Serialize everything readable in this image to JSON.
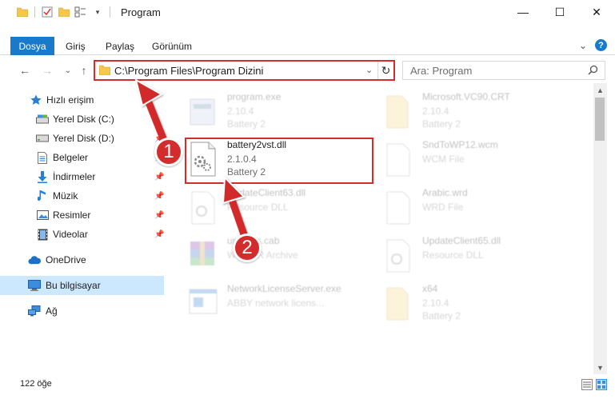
{
  "window": {
    "title": "Program",
    "minimize_glyph": "—",
    "maximize_glyph": "☐",
    "close_glyph": "✕"
  },
  "ribbon": {
    "tabs": [
      "Dosya",
      "Giriş",
      "Paylaş",
      "Görünüm"
    ],
    "help_glyph": "?",
    "expand_glyph": "⌄"
  },
  "nav": {
    "back_glyph": "←",
    "forward_glyph": "→",
    "recent_glyph": "⌄",
    "up_glyph": "↑"
  },
  "address": {
    "path": "C:\\Program Files\\Program Dizini",
    "dropdown_glyph": "⌄",
    "refresh_glyph": "↻"
  },
  "search": {
    "placeholder": "Ara: Program"
  },
  "sidebar": {
    "items": [
      {
        "label": "Hızlı erişim",
        "icon": "star-icon"
      },
      {
        "label": "Yerel Disk (C:)",
        "icon": "drive-icon"
      },
      {
        "label": "Yerel Disk (D:)",
        "icon": "drive-icon"
      },
      {
        "label": "Belgeler",
        "icon": "documents-icon"
      },
      {
        "label": "İndirmeler",
        "icon": "downloads-icon"
      },
      {
        "label": "Müzik",
        "icon": "music-icon"
      },
      {
        "label": "Resimler",
        "icon": "pictures-icon"
      },
      {
        "label": "Videolar",
        "icon": "videos-icon"
      },
      {
        "label": "OneDrive",
        "icon": "cloud-icon"
      },
      {
        "label": "Bu bilgisayar",
        "icon": "computer-icon"
      },
      {
        "label": "Ağ",
        "icon": "network-icon"
      }
    ]
  },
  "files": {
    "items": [
      {
        "name": "program.exe",
        "line2": "2.10.4",
        "line3": "Battery 2"
      },
      {
        "name": "Microsoft.VC90.CRT",
        "line2": "2.10.4",
        "line3": "Battery 2"
      },
      {
        "name": "battery2vst.dll",
        "line2": "2.1.0.4",
        "line3": "Battery 2"
      },
      {
        "name": "SndToWP12.wcm",
        "line2": "WCM File",
        "line3": ""
      },
      {
        "name": "UpdateClient63.dll",
        "line2": "Resource DLL",
        "line3": ""
      },
      {
        "name": "Arabic.wrd",
        "line2": "WRD File",
        "line3": ""
      },
      {
        "name": "updates.cab",
        "line2": "WinRAR Archive",
        "line3": ""
      },
      {
        "name": "UpdateClient65.dll",
        "line2": "Resource DLL",
        "line3": ""
      },
      {
        "name": "NetworkLicenseServer.exe",
        "line2": "ABBY network licens...",
        "line3": ""
      },
      {
        "name": "x64",
        "line2": "2.10.4",
        "line3": "Battery 2"
      }
    ]
  },
  "status": {
    "item_count": "122 öğe"
  },
  "annotations": {
    "step1": "1",
    "step2": "2",
    "highlight_color": "#d22c2c"
  },
  "colors": {
    "accent": "#1979ca",
    "selection": "#cce8ff",
    "folder": "#f5c74d"
  }
}
